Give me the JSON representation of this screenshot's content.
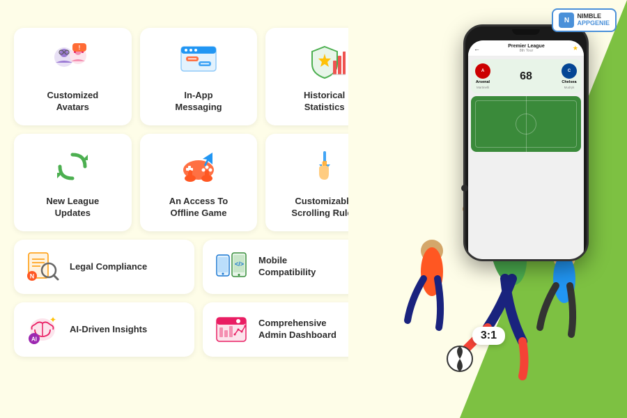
{
  "logo": {
    "name": "NIMBLE\nAPPGENIE",
    "icon": "N"
  },
  "features_top": [
    {
      "id": "customized-avatars",
      "label": "Customized\nAvatars",
      "icon_type": "avatars"
    },
    {
      "id": "in-app-messaging",
      "label": "In-App\nMessaging",
      "icon_type": "messaging"
    },
    {
      "id": "historical-statistics",
      "label": "Historical\nStatistics",
      "icon_type": "statistics"
    },
    {
      "id": "new-league-updates",
      "label": "New League\nUpdates",
      "icon_type": "league"
    },
    {
      "id": "offline-game",
      "label": "An Access To\nOffline Game",
      "icon_type": "offline"
    },
    {
      "id": "scrolling-rules",
      "label": "Customizable\nScrolling Rules",
      "icon_type": "scrolling"
    }
  ],
  "features_bottom": [
    {
      "id": "legal-compliance",
      "label": "Legal Compliance",
      "icon_type": "legal"
    },
    {
      "id": "mobile-compatibility",
      "label": "Mobile\nCompatibility",
      "icon_type": "mobile"
    },
    {
      "id": "ai-insights",
      "label": "AI-Driven Insights",
      "icon_type": "ai"
    },
    {
      "id": "admin-dashboard",
      "label": "Comprehensive\nAdmin Dashboard",
      "icon_type": "admin"
    }
  ],
  "phone": {
    "league_title": "Premier League",
    "league_sub": "8th Tour",
    "score": "68",
    "team1": "Arsenal",
    "team2": "Chelsea",
    "player1": "Martinelli",
    "player2": "Mudryk",
    "score_display": "3:1"
  },
  "colors": {
    "background": "#fefde8",
    "green": "#7dc142",
    "card_bg": "#ffffff",
    "text_dark": "#2c2c2c"
  }
}
